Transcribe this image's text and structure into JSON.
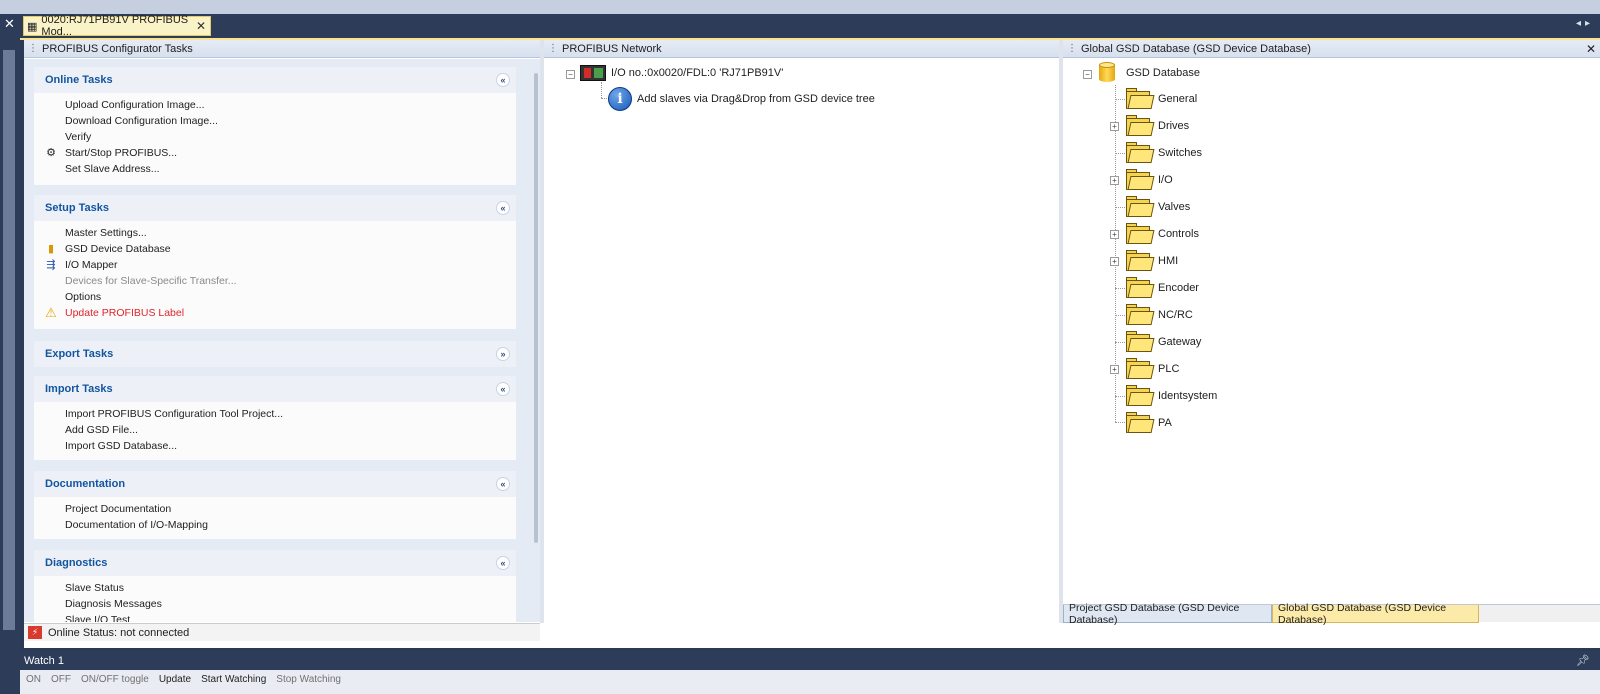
{
  "document_tab": {
    "title": "0020:RJ71PB91V PROFIBUS Mod...",
    "close": "✕"
  },
  "panes": {
    "left_title": "PROFIBUS Configurator Tasks",
    "mid_title": "PROFIBUS Network",
    "right_title": "Global GSD Database (GSD Device Database)"
  },
  "task_groups": [
    {
      "title": "Online Tasks",
      "chevron": "«",
      "items": [
        {
          "label": "Upload Configuration Image...",
          "icon": ""
        },
        {
          "label": "Download Configuration Image...",
          "icon": ""
        },
        {
          "label": "Verify",
          "icon": ""
        },
        {
          "label": "Start/Stop PROFIBUS...",
          "icon": "start-stop-icon"
        },
        {
          "label": "Set Slave Address...",
          "icon": ""
        }
      ]
    },
    {
      "title": "Setup Tasks",
      "chevron": "«",
      "items": [
        {
          "label": "Master Settings...",
          "icon": ""
        },
        {
          "label": "GSD Device Database",
          "icon": "gsd-database-icon"
        },
        {
          "label": "I/O Mapper",
          "icon": "io-mapper-icon"
        },
        {
          "label": "Devices for Slave-Specific Transfer...",
          "icon": "",
          "state": "disabled"
        },
        {
          "label": "Options",
          "icon": ""
        },
        {
          "label": "Update PROFIBUS Label",
          "icon": "warning-icon",
          "state": "warning"
        }
      ]
    },
    {
      "title": "Export Tasks",
      "chevron": "»",
      "items": []
    },
    {
      "title": "Import Tasks",
      "chevron": "«",
      "items": [
        {
          "label": "Import PROFIBUS Configuration Tool Project...",
          "icon": ""
        },
        {
          "label": "Add GSD File...",
          "icon": ""
        },
        {
          "label": "Import GSD Database...",
          "icon": ""
        }
      ]
    },
    {
      "title": "Documentation",
      "chevron": "«",
      "items": [
        {
          "label": "Project Documentation",
          "icon": ""
        },
        {
          "label": "Documentation of I/O-Mapping",
          "icon": ""
        }
      ]
    },
    {
      "title": "Diagnostics",
      "chevron": "«",
      "items": [
        {
          "label": "Slave Status",
          "icon": ""
        },
        {
          "label": "Diagnosis Messages",
          "icon": ""
        },
        {
          "label": "Slave I/O Test",
          "icon": ""
        }
      ]
    }
  ],
  "status": {
    "online": "Online Status: not connected"
  },
  "network": {
    "master_label": "I/O no.:0x0020/FDL:0 'RJ71PB91V'",
    "hint": "Add slaves via Drag&Drop from GSD device tree"
  },
  "gsd_tree": {
    "root": "GSD Database",
    "folders": [
      {
        "label": "General",
        "expandable": false
      },
      {
        "label": "Drives",
        "expandable": true
      },
      {
        "label": "Switches",
        "expandable": false
      },
      {
        "label": "I/O",
        "expandable": true
      },
      {
        "label": "Valves",
        "expandable": false
      },
      {
        "label": "Controls",
        "expandable": true
      },
      {
        "label": "HMI",
        "expandable": true
      },
      {
        "label": "Encoder",
        "expandable": false
      },
      {
        "label": "NC/RC",
        "expandable": false
      },
      {
        "label": "Gateway",
        "expandable": false
      },
      {
        "label": "PLC",
        "expandable": true
      },
      {
        "label": "Identsystem",
        "expandable": false
      },
      {
        "label": "PA",
        "expandable": false
      }
    ]
  },
  "bottom_tabs": {
    "project": "Project GSD Database (GSD Device Database)",
    "global": "Global GSD Database (GSD Device Database)"
  },
  "watch": {
    "title": "Watch 1",
    "toolbar": [
      "ON",
      "OFF",
      "ON/OFF toggle",
      "Update",
      "Start Watching",
      "Stop Watching"
    ]
  }
}
